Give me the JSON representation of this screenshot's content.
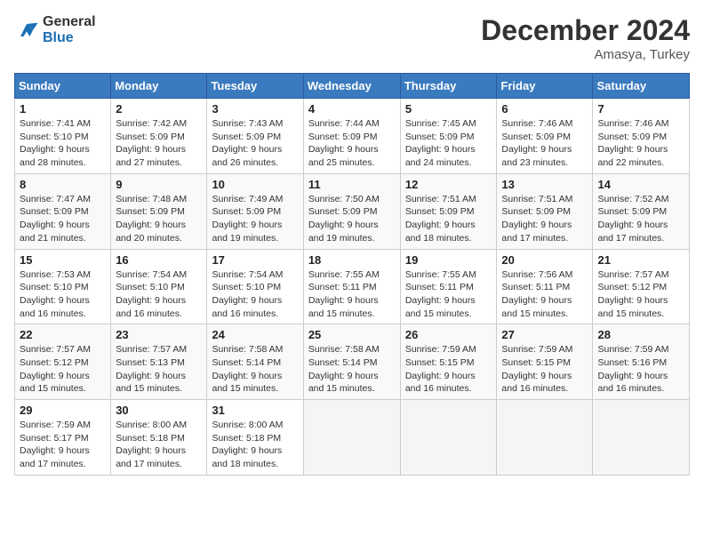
{
  "header": {
    "logo_line1": "General",
    "logo_line2": "Blue",
    "month": "December 2024",
    "location": "Amasya, Turkey"
  },
  "days_of_week": [
    "Sunday",
    "Monday",
    "Tuesday",
    "Wednesday",
    "Thursday",
    "Friday",
    "Saturday"
  ],
  "weeks": [
    [
      {
        "day": "1",
        "sunrise": "Sunrise: 7:41 AM",
        "sunset": "Sunset: 5:10 PM",
        "daylight": "Daylight: 9 hours and 28 minutes."
      },
      {
        "day": "2",
        "sunrise": "Sunrise: 7:42 AM",
        "sunset": "Sunset: 5:09 PM",
        "daylight": "Daylight: 9 hours and 27 minutes."
      },
      {
        "day": "3",
        "sunrise": "Sunrise: 7:43 AM",
        "sunset": "Sunset: 5:09 PM",
        "daylight": "Daylight: 9 hours and 26 minutes."
      },
      {
        "day": "4",
        "sunrise": "Sunrise: 7:44 AM",
        "sunset": "Sunset: 5:09 PM",
        "daylight": "Daylight: 9 hours and 25 minutes."
      },
      {
        "day": "5",
        "sunrise": "Sunrise: 7:45 AM",
        "sunset": "Sunset: 5:09 PM",
        "daylight": "Daylight: 9 hours and 24 minutes."
      },
      {
        "day": "6",
        "sunrise": "Sunrise: 7:46 AM",
        "sunset": "Sunset: 5:09 PM",
        "daylight": "Daylight: 9 hours and 23 minutes."
      },
      {
        "day": "7",
        "sunrise": "Sunrise: 7:46 AM",
        "sunset": "Sunset: 5:09 PM",
        "daylight": "Daylight: 9 hours and 22 minutes."
      }
    ],
    [
      {
        "day": "8",
        "sunrise": "Sunrise: 7:47 AM",
        "sunset": "Sunset: 5:09 PM",
        "daylight": "Daylight: 9 hours and 21 minutes."
      },
      {
        "day": "9",
        "sunrise": "Sunrise: 7:48 AM",
        "sunset": "Sunset: 5:09 PM",
        "daylight": "Daylight: 9 hours and 20 minutes."
      },
      {
        "day": "10",
        "sunrise": "Sunrise: 7:49 AM",
        "sunset": "Sunset: 5:09 PM",
        "daylight": "Daylight: 9 hours and 19 minutes."
      },
      {
        "day": "11",
        "sunrise": "Sunrise: 7:50 AM",
        "sunset": "Sunset: 5:09 PM",
        "daylight": "Daylight: 9 hours and 19 minutes."
      },
      {
        "day": "12",
        "sunrise": "Sunrise: 7:51 AM",
        "sunset": "Sunset: 5:09 PM",
        "daylight": "Daylight: 9 hours and 18 minutes."
      },
      {
        "day": "13",
        "sunrise": "Sunrise: 7:51 AM",
        "sunset": "Sunset: 5:09 PM",
        "daylight": "Daylight: 9 hours and 17 minutes."
      },
      {
        "day": "14",
        "sunrise": "Sunrise: 7:52 AM",
        "sunset": "Sunset: 5:09 PM",
        "daylight": "Daylight: 9 hours and 17 minutes."
      }
    ],
    [
      {
        "day": "15",
        "sunrise": "Sunrise: 7:53 AM",
        "sunset": "Sunset: 5:10 PM",
        "daylight": "Daylight: 9 hours and 16 minutes."
      },
      {
        "day": "16",
        "sunrise": "Sunrise: 7:54 AM",
        "sunset": "Sunset: 5:10 PM",
        "daylight": "Daylight: 9 hours and 16 minutes."
      },
      {
        "day": "17",
        "sunrise": "Sunrise: 7:54 AM",
        "sunset": "Sunset: 5:10 PM",
        "daylight": "Daylight: 9 hours and 16 minutes."
      },
      {
        "day": "18",
        "sunrise": "Sunrise: 7:55 AM",
        "sunset": "Sunset: 5:11 PM",
        "daylight": "Daylight: 9 hours and 15 minutes."
      },
      {
        "day": "19",
        "sunrise": "Sunrise: 7:55 AM",
        "sunset": "Sunset: 5:11 PM",
        "daylight": "Daylight: 9 hours and 15 minutes."
      },
      {
        "day": "20",
        "sunrise": "Sunrise: 7:56 AM",
        "sunset": "Sunset: 5:11 PM",
        "daylight": "Daylight: 9 hours and 15 minutes."
      },
      {
        "day": "21",
        "sunrise": "Sunrise: 7:57 AM",
        "sunset": "Sunset: 5:12 PM",
        "daylight": "Daylight: 9 hours and 15 minutes."
      }
    ],
    [
      {
        "day": "22",
        "sunrise": "Sunrise: 7:57 AM",
        "sunset": "Sunset: 5:12 PM",
        "daylight": "Daylight: 9 hours and 15 minutes."
      },
      {
        "day": "23",
        "sunrise": "Sunrise: 7:57 AM",
        "sunset": "Sunset: 5:13 PM",
        "daylight": "Daylight: 9 hours and 15 minutes."
      },
      {
        "day": "24",
        "sunrise": "Sunrise: 7:58 AM",
        "sunset": "Sunset: 5:14 PM",
        "daylight": "Daylight: 9 hours and 15 minutes."
      },
      {
        "day": "25",
        "sunrise": "Sunrise: 7:58 AM",
        "sunset": "Sunset: 5:14 PM",
        "daylight": "Daylight: 9 hours and 15 minutes."
      },
      {
        "day": "26",
        "sunrise": "Sunrise: 7:59 AM",
        "sunset": "Sunset: 5:15 PM",
        "daylight": "Daylight: 9 hours and 16 minutes."
      },
      {
        "day": "27",
        "sunrise": "Sunrise: 7:59 AM",
        "sunset": "Sunset: 5:15 PM",
        "daylight": "Daylight: 9 hours and 16 minutes."
      },
      {
        "day": "28",
        "sunrise": "Sunrise: 7:59 AM",
        "sunset": "Sunset: 5:16 PM",
        "daylight": "Daylight: 9 hours and 16 minutes."
      }
    ],
    [
      {
        "day": "29",
        "sunrise": "Sunrise: 7:59 AM",
        "sunset": "Sunset: 5:17 PM",
        "daylight": "Daylight: 9 hours and 17 minutes."
      },
      {
        "day": "30",
        "sunrise": "Sunrise: 8:00 AM",
        "sunset": "Sunset: 5:18 PM",
        "daylight": "Daylight: 9 hours and 17 minutes."
      },
      {
        "day": "31",
        "sunrise": "Sunrise: 8:00 AM",
        "sunset": "Sunset: 5:18 PM",
        "daylight": "Daylight: 9 hours and 18 minutes."
      },
      null,
      null,
      null,
      null
    ]
  ]
}
